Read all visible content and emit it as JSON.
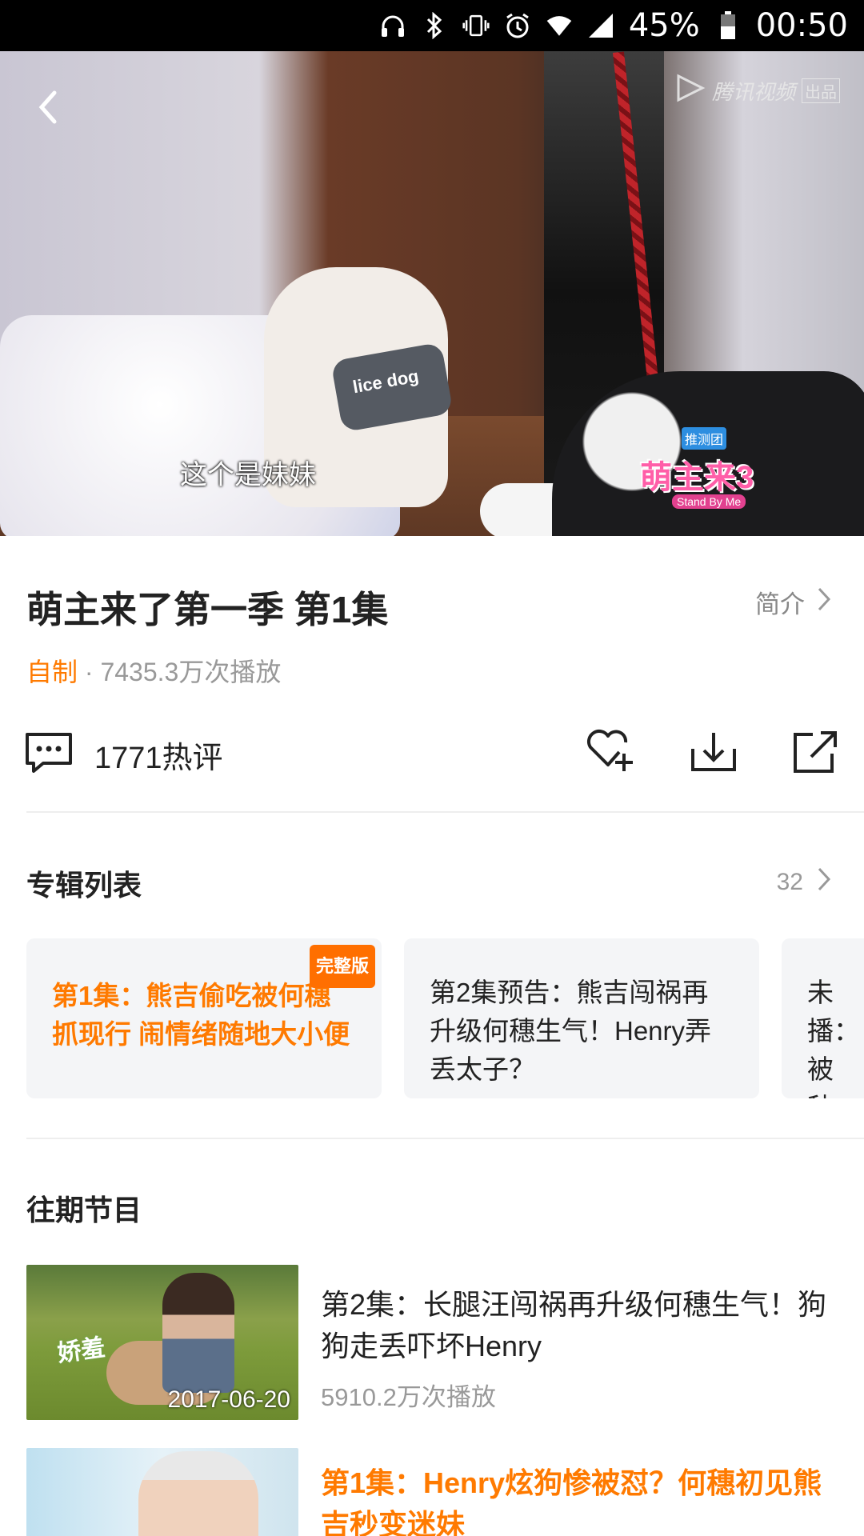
{
  "status_bar": {
    "battery": "45%",
    "time": "00:50",
    "icons": [
      "headphones-icon",
      "bluetooth-icon",
      "vibrate-icon",
      "alarm-icon",
      "wifi-icon",
      "signal-icon",
      "battery-icon"
    ]
  },
  "video": {
    "subtitle": "这个是妹妹",
    "watermark": "腾讯视频",
    "watermark_suffix": "出品",
    "vest_text": "lice dog",
    "show_logo_text": "萌主来3",
    "show_logo_sub": "Stand By Me",
    "show_logo_top": "推测团"
  },
  "info": {
    "title": "萌主来了第一季 第1集",
    "intro_label": "简介",
    "tag": "自制",
    "separator": " · ",
    "views": "7435.3万次播放"
  },
  "actions": {
    "comments": "1771热评",
    "icons": [
      "comment-icon",
      "favorite-add-icon",
      "download-icon",
      "share-icon"
    ]
  },
  "album": {
    "title": "专辑列表",
    "count": "32",
    "episodes": [
      {
        "title": "第1集：熊吉偷吃被何穗抓现行 闹情绪随地大小便",
        "badge": "完整版"
      },
      {
        "title": "第2集预告：熊吉闯祸再升级何穗生气！Henry弄丢太子？"
      },
      {
        "title": "未播：被秒：绎“重"
      }
    ]
  },
  "past": {
    "title": "往期节目",
    "items": [
      {
        "title": "第2集：长腿汪闯祸再升级何穗生气！狗狗走丢吓坏Henry",
        "views": "5910.2万次播放",
        "date": "2017-06-20",
        "thumb_text": "娇羞"
      },
      {
        "title": "第1集：Henry炫狗惨被怼？何穗初见熊吉秒变迷妹"
      }
    ]
  },
  "colors": {
    "accent": "#ff7a00",
    "badge": "#ff6f00",
    "card_bg": "#f4f5f7",
    "secondary_text": "#999999"
  }
}
